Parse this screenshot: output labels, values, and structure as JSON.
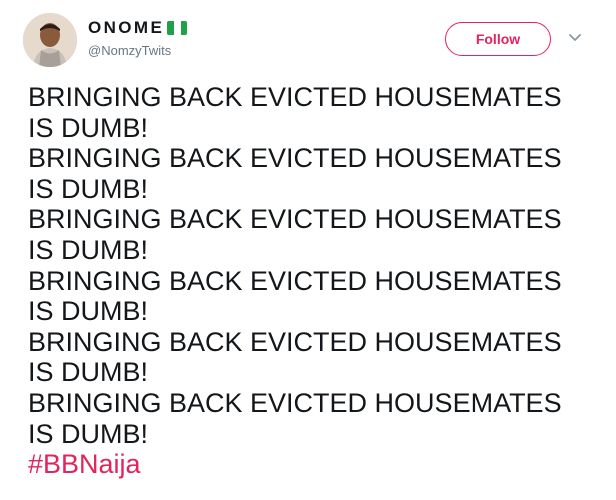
{
  "author": {
    "display_name": "ONOME",
    "handle": "@NomzyTwits"
  },
  "follow_button": {
    "label": "Follow"
  },
  "tweet": {
    "lines": [
      "BRINGING BACK EVICTED HOUSEMATES",
      "IS DUMB!",
      "BRINGING BACK EVICTED HOUSEMATES",
      "IS DUMB!",
      "BRINGING BACK EVICTED HOUSEMATES",
      "IS DUMB!",
      "BRINGING BACK EVICTED HOUSEMATES",
      "IS DUMB!",
      "BRINGING BACK EVICTED HOUSEMATES",
      "IS DUMB!",
      "BRINGING BACK EVICTED HOUSEMATES",
      "IS DUMB!"
    ],
    "hashtag": "#BBNaija"
  },
  "icons": {
    "flag": "nigeria-flag-icon",
    "menu": "chevron-down-icon"
  },
  "colors": {
    "accent": "#e0245e",
    "text": "#14171a",
    "secondary_text": "#657786",
    "flag_green": "#21a04a"
  }
}
